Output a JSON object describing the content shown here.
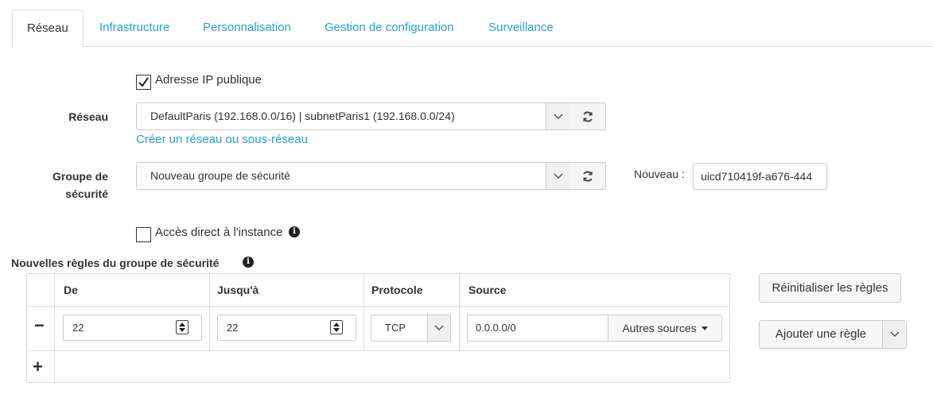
{
  "tabs": [
    {
      "label": "Réseau",
      "active": true
    },
    {
      "label": "Infrastructure",
      "active": false
    },
    {
      "label": "Personnalisation",
      "active": false
    },
    {
      "label": "Gestion de configuration",
      "active": false
    },
    {
      "label": "Surveillance",
      "active": false
    }
  ],
  "public_ip": {
    "label": "Adresse IP publique",
    "checked": true
  },
  "network": {
    "label": "Réseau",
    "selected": "DefaultParis (192.168.0.0/16) | subnetParis1 (192.168.0.0/24)",
    "create_link": "Créer un réseau ou sous-réseau"
  },
  "security_group": {
    "label_line1": "Groupe de",
    "label_line2": "sécurité",
    "selected": "Nouveau groupe de sécurité",
    "new_label": "Nouveau :",
    "new_value": "uicd710419f-a676-444"
  },
  "direct_access": {
    "label": "Accès direct à l'instance",
    "checked": false
  },
  "rules": {
    "title": "Nouvelles règles du groupe de sécurité",
    "headers": {
      "from": "De",
      "to": "Jusqu'à",
      "protocol": "Protocole",
      "source": "Source"
    },
    "row": {
      "remove": "−",
      "from": "22",
      "to": "22",
      "protocol": "TCP",
      "source": "0.0.0.0/0",
      "other_sources": "Autres sources"
    },
    "add": "+",
    "reset_button": "Réinitialiser les règles",
    "add_rule_button": "Ajouter une règle"
  },
  "icons": {
    "caret": "chevron-down-icon",
    "refresh": "refresh-icon",
    "info": "info-icon",
    "check": "check-icon"
  }
}
